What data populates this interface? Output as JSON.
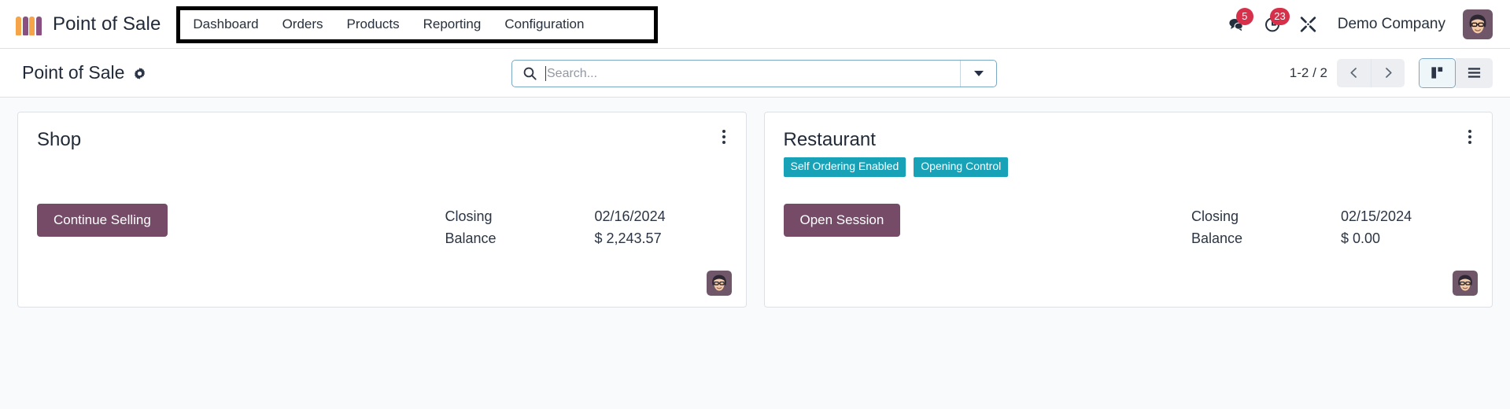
{
  "navbar": {
    "brand": "Point of Sale",
    "brand_logo_icon": "pos-bags-logo-icon",
    "menu": [
      {
        "label": "Dashboard",
        "name": "menu-item-dashboard"
      },
      {
        "label": "Orders",
        "name": "menu-item-orders"
      },
      {
        "label": "Products",
        "name": "menu-item-products"
      },
      {
        "label": "Reporting",
        "name": "menu-item-reporting"
      },
      {
        "label": "Configuration",
        "name": "menu-item-configuration"
      }
    ],
    "messages_badge": "5",
    "activities_badge": "23",
    "company": "Demo Company",
    "accent_badge_color": "#d6304a"
  },
  "control_panel": {
    "breadcrumb_title": "Point of Sale",
    "search_placeholder": "Search...",
    "search_value": "",
    "pager": "1-2 / 2",
    "active_view": "kanban"
  },
  "cards": [
    {
      "title": "Shop",
      "badges": [],
      "action_label": "Continue Selling",
      "stat_label_line1": "Closing",
      "stat_label_line2": "Balance",
      "stat_value_line1": "02/16/2024",
      "stat_value_line2": "$ 2,243.57"
    },
    {
      "title": "Restaurant",
      "badges": [
        "Self Ordering Enabled",
        "Opening Control"
      ],
      "action_label": "Open Session",
      "stat_label_line1": "Closing",
      "stat_label_line2": "Balance",
      "stat_value_line1": "02/15/2024",
      "stat_value_line2": "$ 0.00"
    }
  ],
  "colors": {
    "brand_orange": "#f5a44a",
    "brand_purple": "#8a5082",
    "button_purple": "#754b68",
    "badge_teal": "#17a2b8",
    "notification_red": "#d6304a"
  }
}
